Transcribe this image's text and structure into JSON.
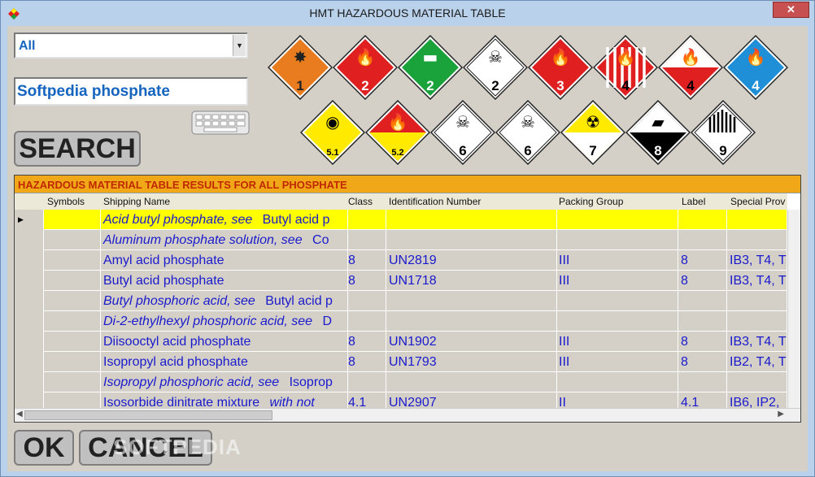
{
  "window": {
    "title": "HMT HAZARDOUS MATERIAL TABLE",
    "close_label": "✕"
  },
  "filter": {
    "selected": "All"
  },
  "search": {
    "value": "Softpedia phosphate",
    "button_label": "SEARCH"
  },
  "placards": [
    {
      "label": "1",
      "icon": "explosive-icon",
      "bg": "#e87c1e",
      "fg": "#222"
    },
    {
      "label": "2",
      "icon": "flame-icon",
      "bg": "#e02020",
      "fg": "#fff"
    },
    {
      "label": "2",
      "icon": "gas-cylinder-icon",
      "bg": "#1aa33a",
      "fg": "#fff"
    },
    {
      "label": "2",
      "icon": "skull-icon",
      "bg": "#ffffff",
      "fg": "#000"
    },
    {
      "label": "3",
      "icon": "flame-icon",
      "bg": "#e02020",
      "fg": "#fff"
    },
    {
      "label": "4",
      "icon": "flame-striped-icon",
      "bg": "#e02020",
      "fg": "#000"
    },
    {
      "label": "4",
      "icon": "flame-icon",
      "bg": "#e02020",
      "fg": "#000"
    },
    {
      "label": "4",
      "icon": "flame-icon",
      "bg": "#1f8fd8",
      "fg": "#fff"
    },
    {
      "label": "5.1",
      "icon": "oxidizer-icon",
      "bg": "#ffea00",
      "fg": "#000"
    },
    {
      "label": "5.2",
      "icon": "flame-icon",
      "bg": "#e02020",
      "fg": "#000"
    },
    {
      "label": "6",
      "icon": "skull-icon",
      "bg": "#ffffff",
      "fg": "#000"
    },
    {
      "label": "6",
      "icon": "skull-icon",
      "bg": "#ffffff",
      "fg": "#000"
    },
    {
      "label": "7",
      "icon": "radioactive-icon",
      "bg": "#ffea00",
      "fg": "#000"
    },
    {
      "label": "8",
      "icon": "corrosive-icon",
      "bg": "#000000",
      "fg": "#fff"
    },
    {
      "label": "9",
      "icon": "striped-icon",
      "bg": "#ffffff",
      "fg": "#000"
    }
  ],
  "grid": {
    "caption": "HAZARDOUS MATERIAL TABLE RESULTS FOR ALL PHOSPHATE",
    "columns": [
      "Symbols",
      "Shipping Name",
      "Class",
      "Identification Number",
      "Packing Group",
      "Label",
      "Special Prov"
    ],
    "rows": [
      {
        "name": "Acid butyl phosphate, see",
        "see": "Butyl acid p",
        "italic": true,
        "class": "",
        "id": "",
        "pg": "",
        "label": "",
        "sp": "",
        "selected": true
      },
      {
        "name": "Aluminum phosphate solution, see",
        "see": "Co",
        "italic": true,
        "class": "",
        "id": "",
        "pg": "",
        "label": "",
        "sp": ""
      },
      {
        "name": "Amyl acid phosphate",
        "see": "",
        "italic": false,
        "class": "8",
        "id": "UN2819",
        "pg": "III",
        "label": "8",
        "sp": "IB3, T4, T"
      },
      {
        "name": "Butyl acid phosphate",
        "see": "",
        "italic": false,
        "class": "8",
        "id": "UN1718",
        "pg": "III",
        "label": "8",
        "sp": "IB3, T4, T"
      },
      {
        "name": "Butyl phosphoric acid, see",
        "see": "Butyl acid p",
        "italic": true,
        "class": "",
        "id": "",
        "pg": "",
        "label": "",
        "sp": ""
      },
      {
        "name": "Di-2-ethylhexyl phosphoric acid, see",
        "see": "D",
        "italic": true,
        "class": "",
        "id": "",
        "pg": "",
        "label": "",
        "sp": ""
      },
      {
        "name": "Diisooctyl acid phosphate",
        "see": "",
        "italic": false,
        "class": "8",
        "id": "UN1902",
        "pg": "III",
        "label": "8",
        "sp": "IB3, T4, T"
      },
      {
        "name": "Isopropyl acid phosphate",
        "see": "",
        "italic": false,
        "class": "8",
        "id": "UN1793",
        "pg": "III",
        "label": "8",
        "sp": "IB2, T4, T"
      },
      {
        "name": "Isopropyl phosphoric acid, see",
        "see": "Isoprop",
        "italic": true,
        "class": "",
        "id": "",
        "pg": "",
        "label": "",
        "sp": ""
      },
      {
        "name": "Isosorbide dinitrate mixture",
        "see": "with not",
        "italic": false,
        "class": "4.1",
        "id": "UN2907",
        "pg": "II",
        "label": "4.1",
        "sp": "IB6, IP2,"
      }
    ]
  },
  "buttons": {
    "ok": "OK",
    "cancel": "CANCEL"
  },
  "watermark": "SOFTPEDIA"
}
